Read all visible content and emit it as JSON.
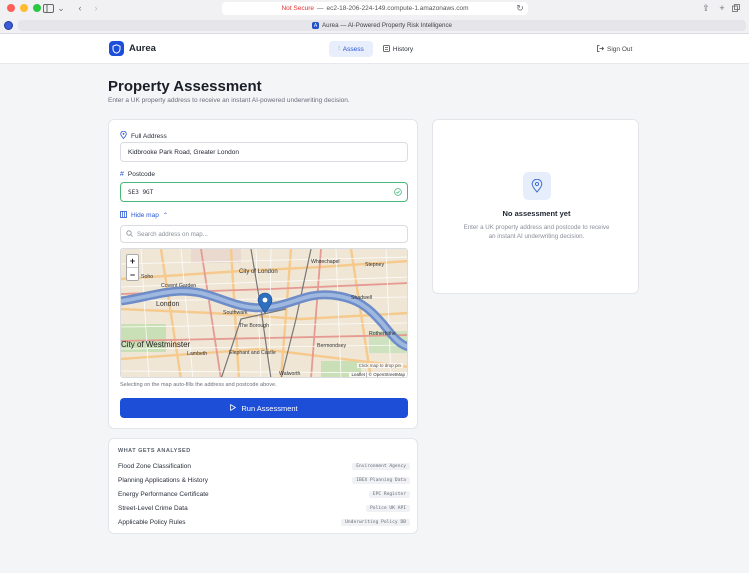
{
  "browser": {
    "url_warning": "Not Secure",
    "url": "ec2-18-206-224-149.compute-1.amazonaws.com",
    "tab_title": "Aurea — AI-Powered Property Risk Intelligence"
  },
  "header": {
    "brand": "Aurea",
    "nav": {
      "assess": "Assess",
      "history": "History"
    },
    "sign_out": "Sign Out"
  },
  "page": {
    "title": "Property Assessment",
    "subtitle": "Enter a UK property address to receive an instant AI-powered underwriting decision."
  },
  "form": {
    "address_label": "Full Address",
    "address_value": "Kidbrooke Park Road, Greater London",
    "postcode_label": "Postcode",
    "postcode_value": "SE3 9GT",
    "hide_map": "Hide map",
    "map_search_placeholder": "Search address on map...",
    "map_note": "Selecting on the map auto-fills the address and postcode above.",
    "run_button": "Run Assessment"
  },
  "map": {
    "zoom_in": "+",
    "zoom_out": "−",
    "hint": "Click map to drop pin",
    "attribution": "Leaflet | © OpenStreetMap",
    "labels": [
      "Whitechapel",
      "Stepney",
      "City of London",
      "Soho",
      "Covent Garden",
      "London",
      "Southwark",
      "Shadwell",
      "Rotherhithe",
      "City of Westminster",
      "Lambeth",
      "The Borough",
      "Elephant and Castle",
      "Bermondsey",
      "Walworth"
    ]
  },
  "analysed": {
    "heading": "WHAT GETS ANALYSED",
    "items": [
      {
        "name": "Flood Zone Classification",
        "source": "Environment Agency"
      },
      {
        "name": "Planning Applications & History",
        "source": "IBEX Planning Data"
      },
      {
        "name": "Energy Performance Certificate",
        "source": "EPC Register"
      },
      {
        "name": "Street-Level Crime Data",
        "source": "Police UK API"
      },
      {
        "name": "Applicable Policy Rules",
        "source": "Underwriting Policy DB"
      }
    ]
  },
  "result": {
    "title": "No assessment yet",
    "description": "Enter a UK property address and postcode to receive an instant AI underwriting decision."
  },
  "colors": {
    "accent": "#1d4ed8",
    "valid": "#46b97a",
    "river": "#6d8cc8"
  }
}
